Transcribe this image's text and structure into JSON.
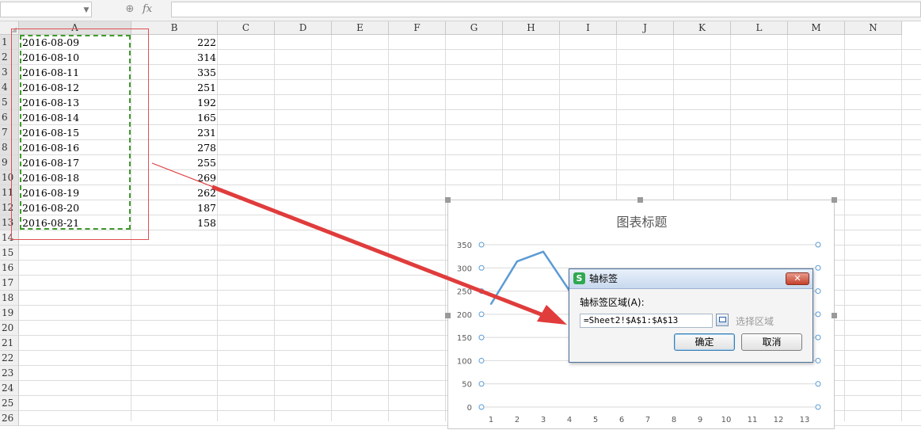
{
  "formula_bar": {
    "name_box_value": "",
    "fx_label": "fx",
    "formula_value": ""
  },
  "columns": [
    "A",
    "B",
    "C",
    "D",
    "E",
    "F",
    "G",
    "H",
    "I",
    "J",
    "K",
    "L",
    "M",
    "N"
  ],
  "rows": [
    "1",
    "2",
    "3",
    "4",
    "5",
    "6",
    "7",
    "8",
    "9",
    "10",
    "11",
    "12",
    "13",
    "14",
    "15",
    "16",
    "17",
    "18",
    "19",
    "20",
    "21",
    "22",
    "23",
    "24",
    "25",
    "26"
  ],
  "cells": [
    {
      "a": "2016-08-09",
      "b": "222"
    },
    {
      "a": "2016-08-10",
      "b": "314"
    },
    {
      "a": "2016-08-11",
      "b": "335"
    },
    {
      "a": "2016-08-12",
      "b": "251"
    },
    {
      "a": "2016-08-13",
      "b": "192"
    },
    {
      "a": "2016-08-14",
      "b": "165"
    },
    {
      "a": "2016-08-15",
      "b": "231"
    },
    {
      "a": "2016-08-16",
      "b": "278"
    },
    {
      "a": "2016-08-17",
      "b": "255"
    },
    {
      "a": "2016-08-18",
      "b": "269"
    },
    {
      "a": "2016-08-19",
      "b": "262"
    },
    {
      "a": "2016-08-20",
      "b": "187"
    },
    {
      "a": "2016-08-21",
      "b": "158"
    }
  ],
  "chart": {
    "title": "图表标题",
    "colors": {
      "line": "#5b9bd5",
      "marker": "#5b9bd5",
      "grid": "#d9d9d9",
      "tick": "#595959"
    }
  },
  "chart_data": {
    "type": "line",
    "title": "图表标题",
    "x": [
      "1",
      "2",
      "3",
      "4",
      "5",
      "6",
      "7",
      "8",
      "9",
      "10",
      "11",
      "12",
      "13"
    ],
    "series": [
      {
        "values": [
          222,
          314,
          335,
          251,
          192,
          165,
          231,
          278,
          255,
          269,
          262,
          187,
          158
        ]
      }
    ],
    "yticks": [
      "0",
      "50",
      "100",
      "150",
      "200",
      "250",
      "300",
      "350"
    ],
    "ylim": [
      0,
      350
    ],
    "grid": true
  },
  "dialog": {
    "app_icon": "S",
    "title": "轴标签",
    "close": "✕",
    "range_label": "轴标签区域(A):",
    "range_value": "=Sheet2!$A$1:$A$13",
    "select_range": "选择区域",
    "ok": "确定",
    "cancel": "取消"
  },
  "icons": {
    "zoom": "⊕",
    "dropdown": "▼"
  }
}
